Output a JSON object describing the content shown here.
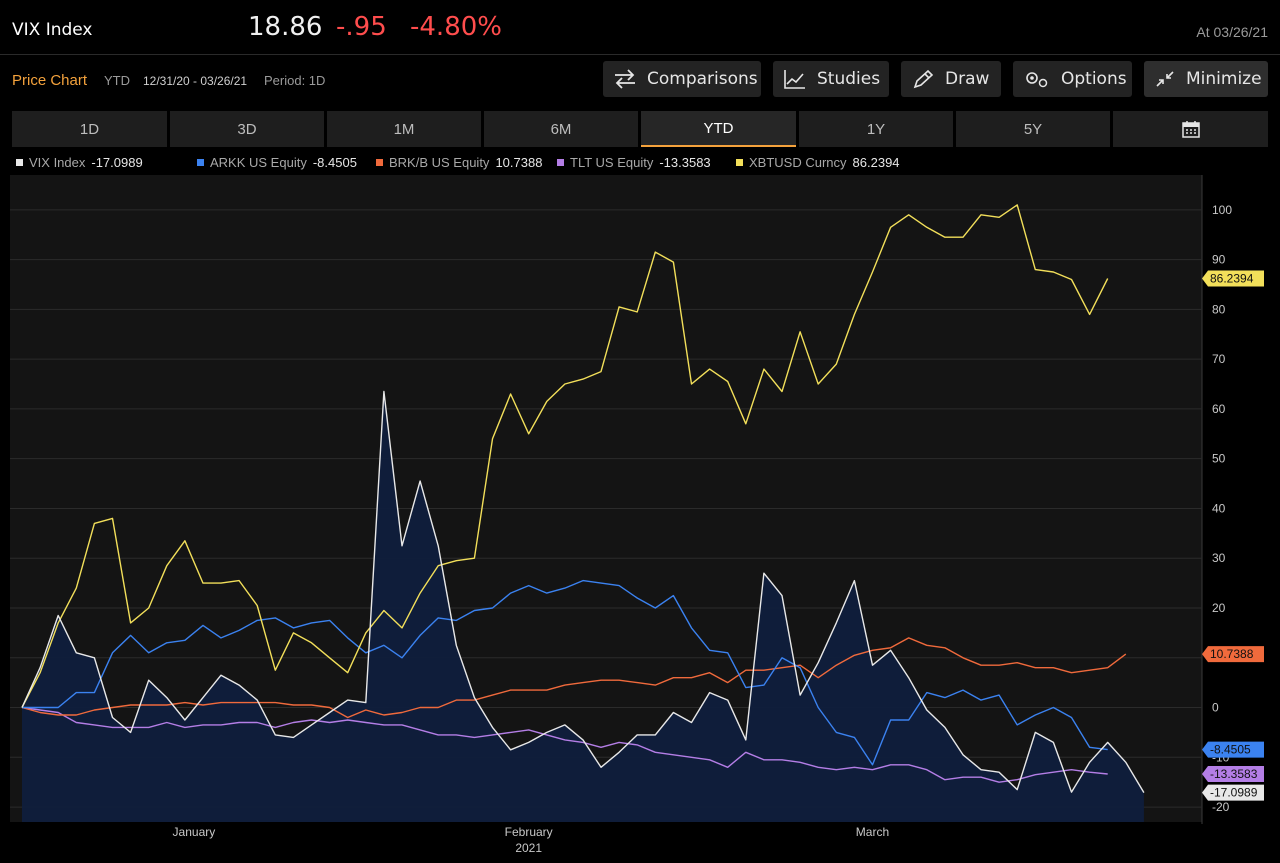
{
  "header": {
    "ticker": "VIX Index",
    "price": "18.86",
    "change": "-.95",
    "change_pct": "-4.80%",
    "as_of": "At 03/26/21"
  },
  "toolbar": {
    "title": "Price Chart",
    "mode": "YTD",
    "range": "12/31/20 - 03/26/21",
    "period": "Period: 1D",
    "buttons": {
      "comparisons": "Comparisons",
      "studies": "Studies",
      "draw": "Draw",
      "options": "Options",
      "minimize": "Minimize"
    }
  },
  "tabs": [
    {
      "label": "1D"
    },
    {
      "label": "3D"
    },
    {
      "label": "1M"
    },
    {
      "label": "6M"
    },
    {
      "label": "YTD"
    },
    {
      "label": "1Y"
    },
    {
      "label": "5Y"
    },
    {
      "label": ""
    }
  ],
  "active_tab": 4,
  "chart_data": {
    "type": "line",
    "ylim": [
      -23,
      107
    ],
    "yticks": [
      100,
      90,
      80,
      70,
      60,
      50,
      40,
      30,
      20,
      10,
      0,
      -10,
      -20
    ],
    "xlim": [
      0,
      63
    ],
    "x_labels": [
      {
        "x": 9.5,
        "label": "January"
      },
      {
        "x": 28,
        "label": "February"
      },
      {
        "x": 47,
        "label": "March"
      }
    ],
    "x_sublabel": {
      "x": 28,
      "label": "2021"
    },
    "grid": true,
    "series": [
      {
        "name": "XBTUSD Curncy",
        "value": "86.2394",
        "color": "#f2df5a",
        "values": [
          0,
          7,
          17,
          24,
          37,
          38,
          17,
          20,
          28.5,
          33.5,
          25,
          25,
          25.5,
          20.5,
          7.5,
          15,
          13,
          10,
          7,
          15,
          19.5,
          16,
          23,
          28.5,
          29.5,
          30,
          54,
          63,
          55,
          61.5,
          65,
          66,
          67.5,
          80.5,
          79.5,
          91.5,
          89.5,
          65,
          68,
          65.5,
          57,
          68,
          63.5,
          75.5,
          65,
          69,
          79,
          87.5,
          96.5,
          99,
          96.5,
          94.5,
          94.5,
          99,
          98.5,
          101,
          88,
          87.5,
          86,
          79,
          86.2
        ]
      },
      {
        "name": "ARKK US Equity",
        "value": "-8.4505",
        "color": "#3b82f0",
        "values": [
          0,
          0,
          0,
          3,
          3,
          11,
          14.5,
          11,
          13,
          13.5,
          16.5,
          14,
          15.5,
          17.5,
          18,
          16,
          17,
          17.5,
          14,
          11,
          12.5,
          10,
          14.5,
          18,
          17.5,
          19.5,
          20,
          23,
          24.5,
          23,
          24,
          25.5,
          25,
          24.5,
          22,
          20,
          22.5,
          16,
          11.5,
          11,
          4,
          4.5,
          10,
          8,
          0,
          -5,
          -6,
          -11.5,
          -2.5,
          -2.5,
          3,
          2,
          3.5,
          1.5,
          2.5,
          -3.5,
          -1.5,
          0,
          -2,
          -8,
          -8.45
        ]
      },
      {
        "name": "BRK/B US Equity",
        "value": "10.7388",
        "color": "#f06a3c",
        "values": [
          0,
          -1,
          -1.5,
          -1.5,
          -0.5,
          0,
          0.5,
          0.5,
          0.5,
          1,
          0.5,
          1,
          1,
          1,
          1,
          0.5,
          0.5,
          0,
          -2,
          -0.5,
          -1.5,
          -1,
          0,
          0,
          1.5,
          1.5,
          2.5,
          3.5,
          3.5,
          3.5,
          4.5,
          5,
          5.5,
          5.5,
          5,
          4.5,
          6,
          6,
          7,
          5,
          7.5,
          7.5,
          8,
          8.5,
          6,
          8.5,
          10.5,
          11.5,
          12,
          14,
          12.5,
          12,
          10,
          8.5,
          8.5,
          9,
          8,
          8,
          7,
          7.5,
          8,
          10.74
        ]
      },
      {
        "name": "TLT US Equity",
        "value": "-13.3583",
        "color": "#b47ee6",
        "values": [
          0,
          -0.5,
          -1,
          -3,
          -3.5,
          -4,
          -4,
          -4,
          -3,
          -4,
          -3.5,
          -3.5,
          -3,
          -3,
          -4,
          -3,
          -2.5,
          -3,
          -2.5,
          -3,
          -3.5,
          -3.5,
          -4.5,
          -5.5,
          -5.5,
          -6,
          -5.5,
          -5,
          -4.5,
          -5.5,
          -6.5,
          -7,
          -8,
          -7,
          -7.5,
          -9,
          -9.5,
          -10,
          -10.5,
          -12,
          -9,
          -10.5,
          -10.5,
          -11,
          -12,
          -12.5,
          -12,
          -12.5,
          -11.5,
          -11.5,
          -12.5,
          -14.5,
          -14,
          -14,
          -15,
          -14.5,
          -13.5,
          -13,
          -12.5,
          -13,
          -13.36
        ]
      },
      {
        "name": "VIX Index",
        "value": "-17.0989",
        "color": "#e8e8e8",
        "values": [
          0,
          8,
          18.5,
          11,
          10,
          -2,
          -5,
          5.5,
          2,
          -2.5,
          2,
          6.5,
          4.5,
          1.5,
          -5.5,
          -6,
          -3.5,
          -1,
          1.5,
          1,
          63.5,
          32.5,
          45.5,
          32.5,
          12.5,
          2,
          -4,
          -8.5,
          -7,
          -5,
          -3.5,
          -6.5,
          -12,
          -9,
          -5.5,
          -5.5,
          -1,
          -3,
          3,
          1.5,
          -6.5,
          27,
          22.5,
          2.5,
          9,
          17,
          25.5,
          8.5,
          11.5,
          6,
          -0.5,
          -4,
          -9.5,
          -12.5,
          -13,
          -16.5,
          -5,
          -7,
          -17,
          -11,
          -7,
          -11,
          -17.1
        ]
      }
    ]
  }
}
